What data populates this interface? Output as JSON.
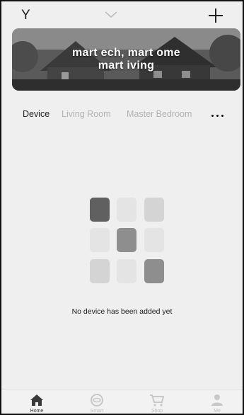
{
  "header": {
    "home_name": "Y",
    "icons": {
      "dropdown": "chevron-down-icon",
      "add": "plus-icon"
    }
  },
  "banner": {
    "line1": "mart ech, mart ome",
    "line2": "mart iving"
  },
  "tabs": [
    {
      "label": "Device",
      "active": true
    },
    {
      "label": "Living Room",
      "active": false
    },
    {
      "label": "Master Bedroom",
      "active": false
    }
  ],
  "empty_state": {
    "message": "No device has been added yet",
    "icon": "device-grid-icon"
  },
  "bottom_nav": [
    {
      "label": "Home",
      "icon": "home-icon",
      "active": true
    },
    {
      "label": "Smart",
      "icon": "smart-icon",
      "active": false
    },
    {
      "label": "Shop",
      "icon": "cart-icon",
      "active": false
    },
    {
      "label": "Me",
      "icon": "person-icon",
      "active": false
    }
  ],
  "colors": {
    "background": "#efefef",
    "active_text": "#222222",
    "inactive_text": "#b3b3b3",
    "grid_dark": "#606060",
    "grid_mid": "#8e8e8e",
    "grid_light": "#d4d4d4",
    "grid_lighter": "#e4e4e4"
  }
}
